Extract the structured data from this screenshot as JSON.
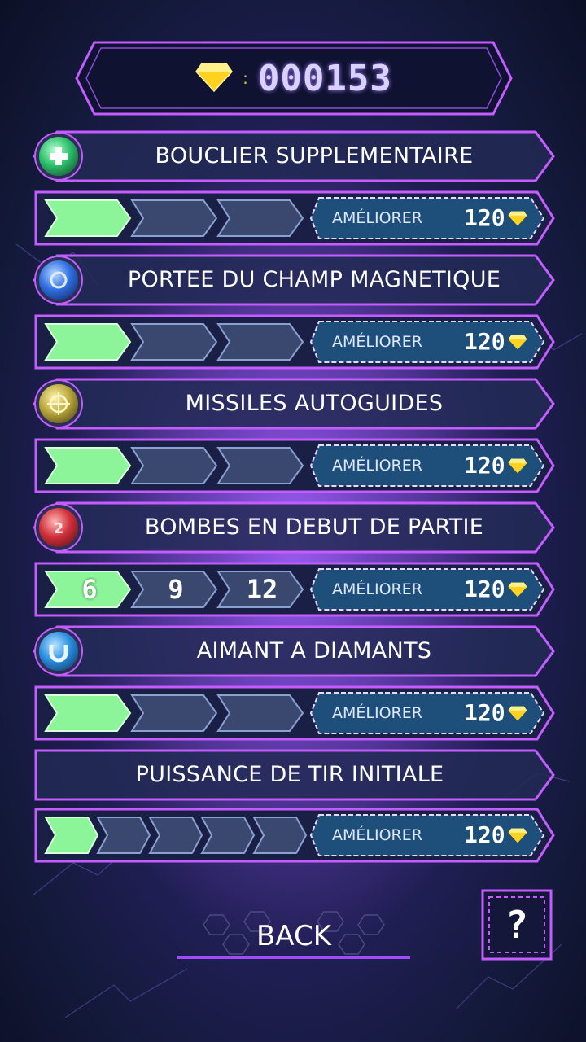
{
  "score": {
    "value": "000153"
  },
  "upgrades": [
    {
      "title": "BOUCLIER SUPPLEMENTAIRE",
      "icon": "shield-plus-icon",
      "icon_color": "#2bbf6a",
      "level": 1,
      "segments": [
        "",
        "",
        ""
      ],
      "button_label": "AMÉLIORER",
      "cost": "120"
    },
    {
      "title": "PORTEE DU CHAMP MAGNETIQUE",
      "icon": "magnet-field-icon",
      "icon_color": "#2f6fe0",
      "level": 1,
      "segments": [
        "",
        "",
        ""
      ],
      "button_label": "AMÉLIORER",
      "cost": "120"
    },
    {
      "title": "MISSILES AUTOGUIDES",
      "icon": "crosshair-icon",
      "icon_color": "#b9a63a",
      "level": 1,
      "segments": [
        "",
        "",
        ""
      ],
      "button_label": "AMÉLIORER",
      "cost": "120"
    },
    {
      "title": "BOMBES EN DEBUT DE PARTIE",
      "icon": "bomb-icon",
      "icon_color": "#d0303a",
      "level": 1,
      "segments": [
        "6",
        "9",
        "12"
      ],
      "button_label": "AMÉLIORER",
      "cost": "120"
    },
    {
      "title": "AIMANT A DIAMANTS",
      "icon": "magnet-icon",
      "icon_color": "#2a8ee0",
      "level": 1,
      "segments": [
        "",
        "",
        ""
      ],
      "button_label": "AMÉLIORER",
      "cost": "120"
    },
    {
      "title": "PUISSANCE DE TIR INITIALE",
      "icon": "",
      "icon_color": "",
      "level": 1,
      "segments": [
        "",
        "",
        "",
        "",
        ""
      ],
      "button_label": "AMÉLIORER",
      "cost": "120"
    }
  ],
  "back_button": {
    "label": "BACK"
  },
  "help_button": {
    "label": "?"
  },
  "colors": {
    "neon": "#c45cff",
    "bar_on": "#7ef08a",
    "bar_off": "#3a4870",
    "gem": "#ffe14a",
    "upgrade_bg": "#1d4f7a"
  }
}
